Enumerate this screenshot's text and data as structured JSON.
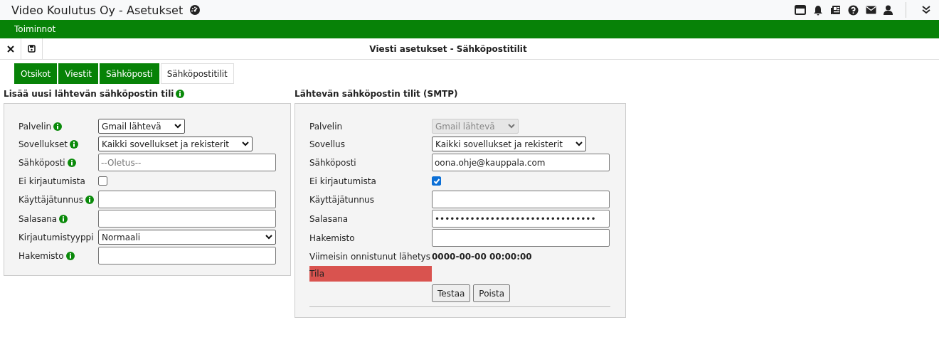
{
  "window": {
    "title": "Video Koulutus Oy - Asetukset"
  },
  "menu_bar": {
    "label": "Toiminnot"
  },
  "page_title": "Viesti asetukset - Sähköpostitilit",
  "tabs": [
    {
      "label": "Otsikot",
      "selected": false
    },
    {
      "label": "Viestit",
      "selected": false
    },
    {
      "label": "Sähköposti",
      "selected": false
    },
    {
      "label": "Sähköpostitilit",
      "selected": true
    }
  ],
  "new_account": {
    "heading": "Lisää uusi lähtevän sähköpostin tili",
    "fields": [
      {
        "label": "Palvelin",
        "info": true,
        "kind": "select",
        "value": "Gmail lähtevä",
        "disabled": false
      },
      {
        "label": "Sovellukset",
        "info": true,
        "kind": "select",
        "value": "Kaikki sovellukset ja rekisterit",
        "disabled": false
      },
      {
        "label": "Sähköposti",
        "info": true,
        "kind": "input",
        "placeholder": "--Oletus--"
      },
      {
        "label": "Ei kirjautumista",
        "info": false,
        "kind": "checkbox",
        "checked": false
      },
      {
        "label": "Käyttäjätunnus",
        "info": true,
        "kind": "input"
      },
      {
        "label": "Salasana",
        "info": true,
        "kind": "input"
      },
      {
        "label": "Kirjautumistyyppi",
        "info": false,
        "kind": "wide_select",
        "value": "Normaali",
        "disabled": false
      },
      {
        "label": "Hakemisto",
        "info": true,
        "kind": "input"
      }
    ]
  },
  "accounts": {
    "heading": "Lähtevän sähköpostin tilit (SMTP)",
    "fields": [
      {
        "label": "Palvelin",
        "kind": "select",
        "value": "Gmail lähtevä",
        "disabled": true
      },
      {
        "label": "Sovellus",
        "kind": "select",
        "value": "Kaikki sovellukset ja rekisterit",
        "disabled": false
      },
      {
        "label": "Sähköposti",
        "kind": "input",
        "value": "oona.ohje@kauppala.com"
      },
      {
        "label": "Ei kirjautumista",
        "kind": "checkbox",
        "checked": true
      },
      {
        "label": "Käyttäjätunnus",
        "kind": "input"
      },
      {
        "label": "Salasana",
        "kind": "input",
        "value": "••••••••••••••••••••••••••••••••"
      },
      {
        "label": "Hakemisto",
        "kind": "input"
      },
      {
        "label": "Viimeisin onnistunut lähetys",
        "kind": "text",
        "value": "0000-00-00 00:00:00"
      }
    ],
    "status": {
      "label": "Tila"
    },
    "buttons": [
      "Testaa",
      "Poista"
    ]
  }
}
